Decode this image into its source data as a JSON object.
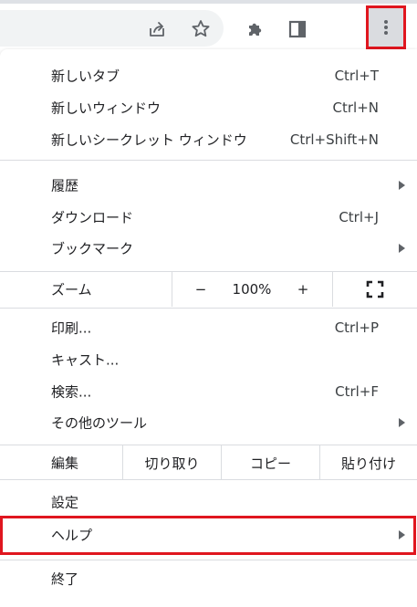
{
  "toolbar": {
    "icons": [
      "share-icon",
      "bookmark-star-icon",
      "extensions-puzzle-icon",
      "side-panel-icon",
      "more-vert-icon"
    ]
  },
  "menu": {
    "new_tab": {
      "label": "新しいタブ",
      "shortcut": "Ctrl+T"
    },
    "new_window": {
      "label": "新しいウィンドウ",
      "shortcut": "Ctrl+N"
    },
    "new_incognito": {
      "label": "新しいシークレット ウィンドウ",
      "shortcut": "Ctrl+Shift+N"
    },
    "history": {
      "label": "履歴"
    },
    "downloads": {
      "label": "ダウンロード",
      "shortcut": "Ctrl+J"
    },
    "bookmarks": {
      "label": "ブックマーク"
    },
    "zoom": {
      "label": "ズーム",
      "minus": "−",
      "value": "100%",
      "plus": "+"
    },
    "print": {
      "label": "印刷...",
      "shortcut": "Ctrl+P"
    },
    "cast": {
      "label": "キャスト..."
    },
    "find": {
      "label": "検索...",
      "shortcut": "Ctrl+F"
    },
    "more_tools": {
      "label": "その他のツール"
    },
    "edit": {
      "label": "編集",
      "cut": "切り取り",
      "copy": "コピー",
      "paste": "貼り付け"
    },
    "settings": {
      "label": "設定"
    },
    "help": {
      "label": "ヘルプ"
    },
    "exit": {
      "label": "終了"
    }
  },
  "colors": {
    "highlight_border": "#e0161f",
    "text": "#202124",
    "separator": "#dadce0"
  }
}
